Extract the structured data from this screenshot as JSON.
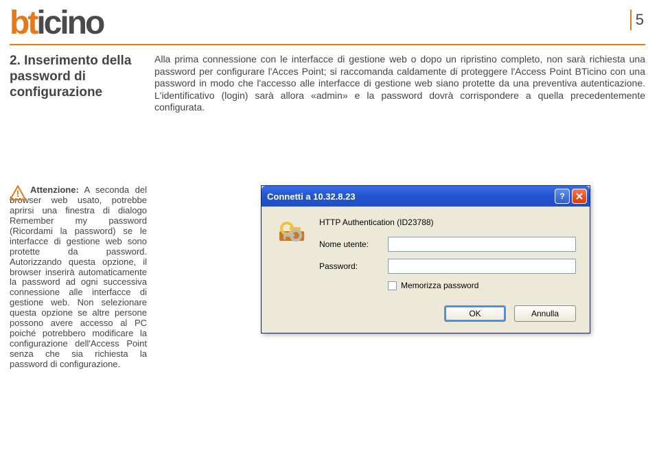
{
  "logo": {
    "part1": "bt",
    "part2": "icino"
  },
  "page_number": "5",
  "section_title": "2. Inserimento della password di configurazione",
  "body_text": "Alla prima connessione con le interfacce di gestione web o dopo un ripristino completo, non sarà richiesta una password per configurare l'Acces Point; si raccomanda caldamente di proteggere l'Access Point BTicino con una password in modo che l'accesso alle interfacce di gestione web siano protette da una preventiva autenticazione. L'identificativo (login) sarà allora «admin» e la password dovrà corrispondere a quella precedentemente configurata.",
  "warning": {
    "bold_lead": "Attenzione:",
    "text": " A seconda del browser web usato, potrebbe aprirsi una finestra di dialogo Remember my password (Ricordami la password) se le interfacce di gestione web sono protette da password. Autorizzando questa opzione, il browser inserirà automaticamente la password ad ogni successiva connessione alle interfacce di gestione web. Non selezionare questa opzione se altre persone possono avere accesso al PC poiché potrebbero modificare la configurazione dell'Access Point senza che sia richiesta la password di configurazione."
  },
  "dialog": {
    "title": "Connetti a 10.32.8.23",
    "auth_label": "HTTP Authentication (ID23788)",
    "username_label": "Nome utente:",
    "username_value": "",
    "password_label": "Password:",
    "password_value": "",
    "remember_label": "Memorizza password",
    "ok_button": "OK",
    "cancel_button": "Annulla"
  }
}
